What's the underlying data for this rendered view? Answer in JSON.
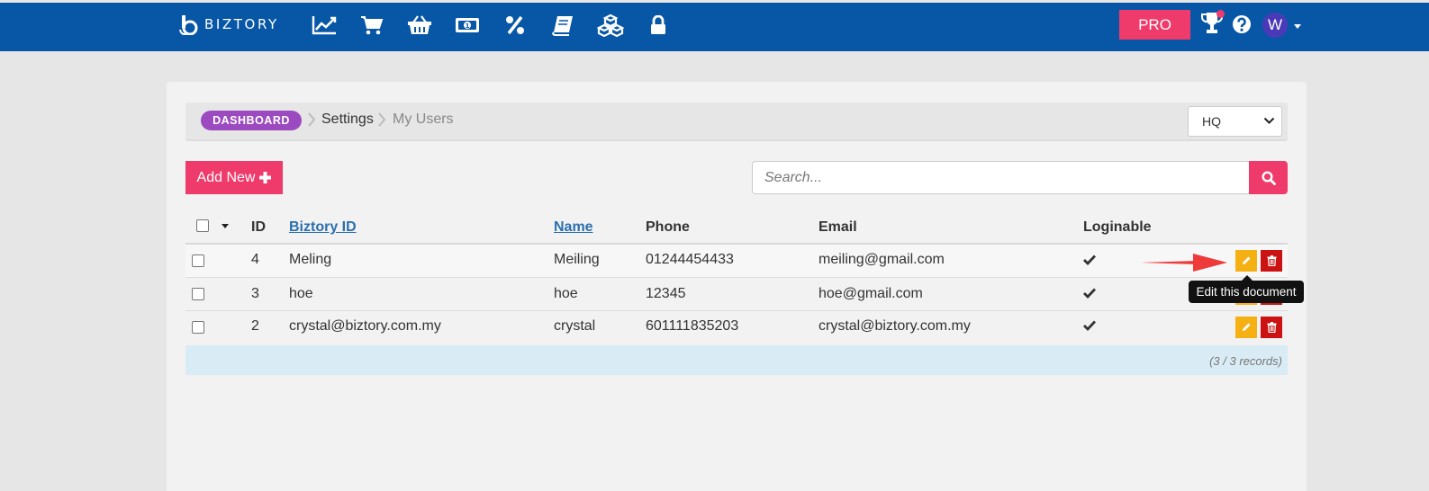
{
  "app": {
    "logo_text": "BIZTORY",
    "pro_label": "PRO",
    "avatar_initial": "W"
  },
  "nav": {
    "icons": [
      "chart-line-icon",
      "cart-icon",
      "basket-icon",
      "money-icon",
      "percent-icon",
      "book-icon",
      "boxes-icon",
      "lock-icon"
    ]
  },
  "breadcrumb": {
    "root": "DASHBOARD",
    "level1": "Settings",
    "current": "My Users"
  },
  "branch_select": {
    "value": "HQ"
  },
  "toolbar": {
    "add_label": "Add New",
    "search_placeholder": "Search..."
  },
  "table": {
    "headers": {
      "id": "ID",
      "biztory_id": "Biztory ID",
      "name": "Name",
      "phone": "Phone",
      "email": "Email",
      "loginable": "Loginable"
    },
    "rows": [
      {
        "id": "4",
        "biztory_id": "Meling",
        "name": "Meiling",
        "phone": "01244454433",
        "email": "meiling@gmail.com",
        "loginable": true
      },
      {
        "id": "3",
        "biztory_id": "hoe",
        "name": "hoe",
        "phone": "12345",
        "email": "hoe@gmail.com",
        "loginable": true
      },
      {
        "id": "2",
        "biztory_id": "crystal@biztory.com.my",
        "name": "crystal",
        "phone": "601111835203",
        "email": "crystal@biztory.com.my",
        "loginable": true
      }
    ],
    "records_text": "(3 / 3 records)"
  },
  "tooltip": {
    "text": "Edit this document"
  },
  "colors": {
    "navbar": "#0857a6",
    "accent": "#ef3b6b",
    "badge": "#9c4ac0",
    "edit": "#f5b014",
    "delete": "#cc1313"
  }
}
